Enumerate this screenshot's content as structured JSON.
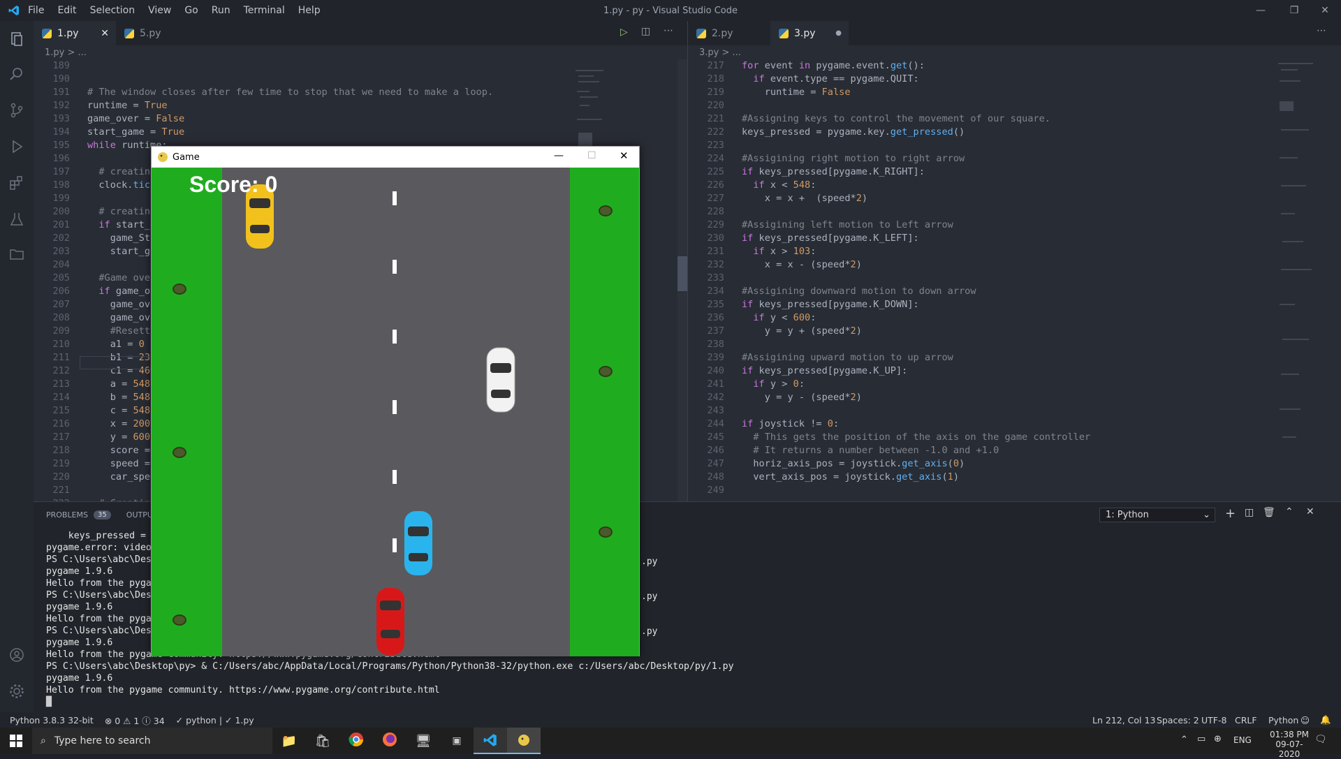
{
  "titlebar": {
    "menu": [
      "File",
      "Edit",
      "Selection",
      "View",
      "Go",
      "Run",
      "Terminal",
      "Help"
    ],
    "title": "1.py - py - Visual Studio Code"
  },
  "left": {
    "tabs": [
      {
        "label": "1.py",
        "active": true
      },
      {
        "label": "5.py",
        "active": false
      }
    ],
    "breadcrumb": "1.py > ...",
    "lines": [
      [
        "189",
        ""
      ],
      [
        "190",
        ""
      ],
      [
        "191",
        "# The window closes after few time to stop that we need to make a loop."
      ],
      [
        "192",
        "runtime = True"
      ],
      [
        "193",
        "game_over = False"
      ],
      [
        "194",
        "start_game = True"
      ],
      [
        "195",
        "while runtime:"
      ],
      [
        "196",
        ""
      ],
      [
        "197",
        "  # creating"
      ],
      [
        "198",
        "  clock.tick("
      ],
      [
        "199",
        ""
      ],
      [
        "200",
        "  # creating"
      ],
      [
        "201",
        "  if start_ga"
      ],
      [
        "202",
        "    game_Star"
      ],
      [
        "203",
        "    start_gam"
      ],
      [
        "204",
        ""
      ],
      [
        "205",
        "  #Game over"
      ],
      [
        "206",
        "  if game_ove"
      ],
      [
        "207",
        "    game_over"
      ],
      [
        "208",
        "    game_over"
      ],
      [
        "209",
        "    #Resettin"
      ],
      [
        "210",
        "    a1 = 0"
      ],
      [
        "211",
        "    b1 = 233"
      ],
      [
        "212",
        "    c1 = 466"
      ],
      [
        "213",
        "    a = 548"
      ],
      [
        "214",
        "    b = 548"
      ],
      [
        "215",
        "    c = 548"
      ],
      [
        "216",
        "    x = 200"
      ],
      [
        "217",
        "    y = 600"
      ],
      [
        "218",
        "    score = -"
      ],
      [
        "219",
        "    speed = 2"
      ],
      [
        "220",
        "    car_speed"
      ],
      [
        "221",
        ""
      ],
      [
        "222",
        "  # Creating"
      ]
    ]
  },
  "right": {
    "tabs": [
      {
        "label": "2.py",
        "active": false
      },
      {
        "label": "3.py",
        "active": true
      }
    ],
    "breadcrumb": "3.py > ...",
    "lines": [
      [
        "217",
        "for event in pygame.event.get():"
      ],
      [
        "218",
        "  if event.type == pygame.QUIT:"
      ],
      [
        "219",
        "    runtime = False"
      ],
      [
        "220",
        ""
      ],
      [
        "221",
        "#Assigning keys to control the movement of our square."
      ],
      [
        "222",
        "keys_pressed = pygame.key.get_pressed()"
      ],
      [
        "223",
        ""
      ],
      [
        "224",
        "#Assigining right motion to right arrow"
      ],
      [
        "225",
        "if keys_pressed[pygame.K_RIGHT]:"
      ],
      [
        "226",
        "  if x < 548:"
      ],
      [
        "227",
        "    x = x +  (speed*2)"
      ],
      [
        "228",
        ""
      ],
      [
        "229",
        "#Assigining left motion to Left arrow"
      ],
      [
        "230",
        "if keys_pressed[pygame.K_LEFT]:"
      ],
      [
        "231",
        "  if x > 103:"
      ],
      [
        "232",
        "    x = x - (speed*2)"
      ],
      [
        "233",
        ""
      ],
      [
        "234",
        "#Assigining downward motion to down arrow"
      ],
      [
        "235",
        "if keys_pressed[pygame.K_DOWN]:"
      ],
      [
        "236",
        "  if y < 600:"
      ],
      [
        "237",
        "    y = y + (speed*2)"
      ],
      [
        "238",
        ""
      ],
      [
        "239",
        "#Assigining upward motion to up arrow"
      ],
      [
        "240",
        "if keys_pressed[pygame.K_UP]:"
      ],
      [
        "241",
        "  if y > 0:"
      ],
      [
        "242",
        "    y = y - (speed*2)"
      ],
      [
        "243",
        ""
      ],
      [
        "244",
        "if joystick != 0:"
      ],
      [
        "245",
        "  # This gets the position of the axis on the game controller"
      ],
      [
        "246",
        "  # It returns a number between -1.0 and +1.0"
      ],
      [
        "247",
        "  horiz_axis_pos = joystick.get_axis(0)"
      ],
      [
        "248",
        "  vert_axis_pos = joystick.get_axis(1)"
      ],
      [
        "249",
        ""
      ]
    ]
  },
  "panel": {
    "problems_label": "PROBLEMS",
    "problems_count": "35",
    "output_label": "OUTPUT",
    "terminal_select": "1: Python",
    "terminal_lines": [
      "    keys_pressed = py",
      "pygame.error: video s",
      "PS C:\\Users\\abc\\Deskt",
      "pygame 1.9.6",
      "Hello from the pygame",
      "PS C:\\Users\\abc\\Deskt",
      "pygame 1.9.6",
      "Hello from the pygame",
      "PS C:\\Users\\abc\\Deskt",
      "pygame 1.9.6",
      "Hello from the pygame community. https://www.pygame.org/contribute.html",
      "PS C:\\Users\\abc\\Desktop\\py> & C:/Users/abc/AppData/Local/Programs/Python/Python38-32/python.exe c:/Users/abc/Desktop/py/1.py",
      "pygame 1.9.6",
      "Hello from the pygame community. https://www.pygame.org/contribute.html",
      ""
    ],
    "right_fragments": [
      ".py",
      ".py",
      ".py"
    ]
  },
  "status": {
    "interpreter": "Python 3.8.3 32-bit",
    "problems": "⊗ 0 ⚠ 1 ⓘ 34",
    "check": "✓ python | ✓ 1.py",
    "position": "Ln 212, Col 13",
    "spaces": "Spaces: 2",
    "encoding": "UTF-8",
    "eol": "CRLF",
    "language": "Python"
  },
  "taskbar": {
    "search_placeholder": "Type here to search",
    "lang": "ENG",
    "time": "01:38 PM",
    "date": "09-07-2020"
  },
  "game": {
    "window_title": "Game",
    "score_label": "Score: 0"
  },
  "colors": {
    "grass": "#1fad1f",
    "road": "#5a5a5e",
    "accent": "#007acc"
  }
}
